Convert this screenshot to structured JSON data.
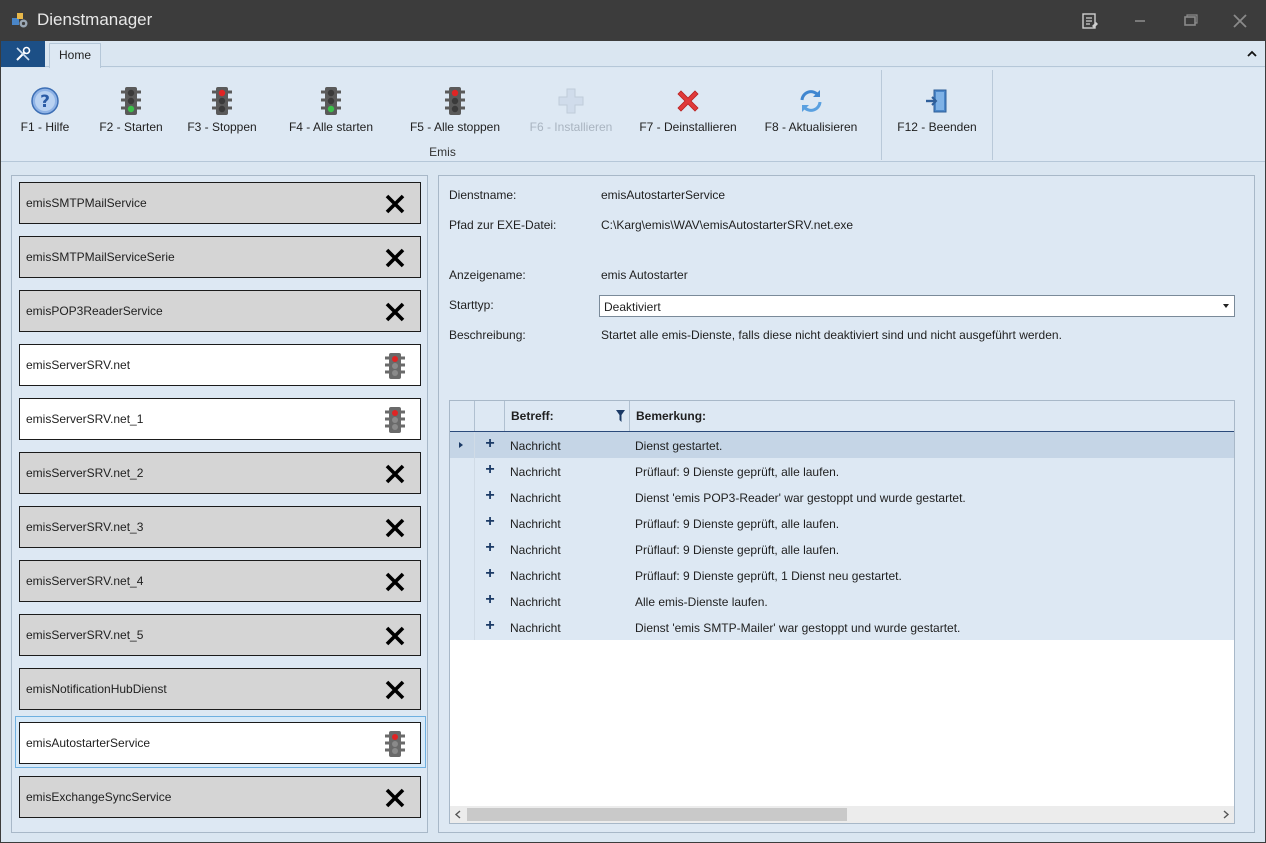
{
  "window": {
    "title": "Dienstmanager"
  },
  "ribbon": {
    "tab": "Home",
    "group_label": "Emis",
    "buttons": [
      {
        "label": "F1 - Hilfe",
        "icon": "help-icon"
      },
      {
        "label": "F2 - Starten",
        "icon": "traffic-light-green-icon"
      },
      {
        "label": "F3 - Stoppen",
        "icon": "traffic-light-red-icon"
      },
      {
        "label": "F4 - Alle starten",
        "icon": "traffic-light-green-icon"
      },
      {
        "label": "F5 - Alle stoppen",
        "icon": "traffic-light-red-icon"
      },
      {
        "label": "F6 - Installieren",
        "icon": "plus-icon",
        "disabled": true
      },
      {
        "label": "F7 - Deinstallieren",
        "icon": "red-x-icon"
      },
      {
        "label": "F8 - Aktualisieren",
        "icon": "refresh-icon"
      },
      {
        "label": "F12 - Beenden",
        "icon": "exit-door-icon"
      }
    ]
  },
  "services": [
    {
      "name": "emisSMTPMailService",
      "status": "stopped"
    },
    {
      "name": "emisSMTPMailServiceSerie",
      "status": "stopped"
    },
    {
      "name": "emisPOP3ReaderService",
      "status": "stopped"
    },
    {
      "name": "emisServerSRV.net",
      "status": "running"
    },
    {
      "name": "emisServerSRV.net_1",
      "status": "running"
    },
    {
      "name": "emisServerSRV.net_2",
      "status": "stopped"
    },
    {
      "name": "emisServerSRV.net_3",
      "status": "stopped"
    },
    {
      "name": "emisServerSRV.net_4",
      "status": "stopped"
    },
    {
      "name": "emisServerSRV.net_5",
      "status": "stopped"
    },
    {
      "name": "emisNotificationHubDienst",
      "status": "stopped"
    },
    {
      "name": "emisAutostarterService",
      "status": "running",
      "selected": true
    },
    {
      "name": "emisExchangeSyncService",
      "status": "stopped"
    }
  ],
  "details": {
    "dienstname_label": "Dienstname:",
    "dienstname": "emisAutostarterService",
    "pfad_label": "Pfad zur EXE-Datei:",
    "pfad": "C:\\Karg\\emis\\WAV\\emisAutostarterSRV.net.exe",
    "anzeigename_label": "Anzeigename:",
    "anzeigename": "emis Autostarter",
    "starttyp_label": "Starttyp:",
    "starttyp": "Deaktiviert",
    "beschreibung_label": "Beschreibung:",
    "beschreibung": "Startet alle emis-Dienste, falls diese nicht deaktiviert sind und nicht ausgeführt werden."
  },
  "log": {
    "columns": {
      "subject": "Betreff:",
      "note": "Bemerkung:"
    },
    "rows": [
      {
        "subject": "Nachricht",
        "note": "Dienst gestartet.",
        "selected": true
      },
      {
        "subject": "Nachricht",
        "note": "Prüflauf: 9 Dienste geprüft, alle laufen."
      },
      {
        "subject": "Nachricht",
        "note": "Dienst 'emis POP3-Reader' war gestoppt und wurde gestartet."
      },
      {
        "subject": "Nachricht",
        "note": "Prüflauf: 9 Dienste geprüft, alle laufen."
      },
      {
        "subject": "Nachricht",
        "note": "Prüflauf: 9 Dienste geprüft, alle laufen."
      },
      {
        "subject": "Nachricht",
        "note": "Prüflauf: 9 Dienste geprüft, 1 Dienst neu gestartet."
      },
      {
        "subject": "Nachricht",
        "note": "Alle emis-Dienste laufen."
      },
      {
        "subject": "Nachricht",
        "note": "Dienst 'emis SMTP-Mailer' war gestoppt und wurde gestartet."
      }
    ]
  }
}
